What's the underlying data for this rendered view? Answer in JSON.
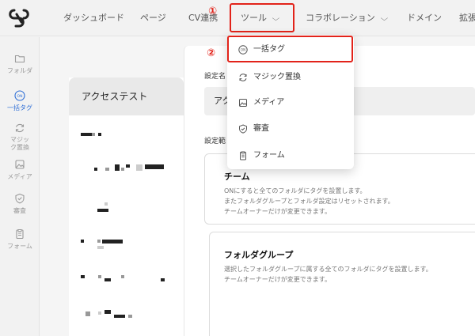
{
  "nav": {
    "items": [
      {
        "label": "ダッシュボード"
      },
      {
        "label": "ページ"
      },
      {
        "label": "CV連携"
      },
      {
        "label": "ツール"
      },
      {
        "label": "コラボレーション"
      },
      {
        "label": "ドメイン"
      },
      {
        "label": "拡張"
      }
    ],
    "marker_1": "①"
  },
  "sidebar": {
    "items": [
      {
        "label": "フォルダ",
        "icon": "folder-icon"
      },
      {
        "label": "一括タグ",
        "icon": "on-tag-icon",
        "badge": "ON"
      },
      {
        "label": "マジック置換",
        "icon": "refresh-icon"
      },
      {
        "label": "メディア",
        "icon": "media-icon"
      },
      {
        "label": "審査",
        "icon": "shield-icon"
      },
      {
        "label": "フォーム",
        "icon": "form-icon"
      }
    ]
  },
  "dropdown": {
    "marker_2": "②",
    "items": [
      {
        "label": "一括タグ",
        "icon": "on-tag-icon",
        "badge": "ON"
      },
      {
        "label": "マジック置換",
        "icon": "refresh-icon"
      },
      {
        "label": "メディア",
        "icon": "media-icon"
      },
      {
        "label": "審査",
        "icon": "shield-icon"
      },
      {
        "label": "フォーム",
        "icon": "form-icon"
      }
    ]
  },
  "list": {
    "header": "アクセステスト"
  },
  "settings": {
    "name_label": "設定名",
    "name_value": "アク",
    "scope_label": "設定範",
    "cards": [
      {
        "title": "チーム",
        "desc": [
          "ONにすると全てのフォルダにタグを設置します。",
          "またフォルダグループとフォルダ設定はリセットされます。",
          "チームオーナーだけが変更できます。"
        ]
      },
      {
        "title": "フォルダグループ",
        "desc": [
          "選択したフォルダグループに属する全てのフォルダにタグを設置します。",
          "チームオーナーだけが変更できます。"
        ]
      }
    ]
  },
  "colors": {
    "accent": "#2f6fd6",
    "highlight": "#e2231a"
  }
}
